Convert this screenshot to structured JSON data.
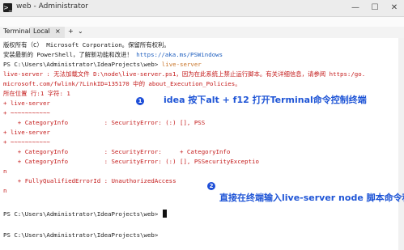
{
  "window": {
    "title": "web - Administrator",
    "app_icon": ">_",
    "minimize": "—",
    "maximize": "☐",
    "close": "✕"
  },
  "tabs": {
    "terminal_label": "Terminal:",
    "active_tab": "Local",
    "close": "×",
    "add": "+",
    "menu": "⌄"
  },
  "terminal": {
    "copyright": "版权所有（C） Microsoft Corporation。保留所有权利。",
    "install_prefix": "安装最新的 PowerShell，了解新功能和改进！",
    "install_link": "https://aka.ms/PSWindows",
    "prompt1": "PS C:\\Users\\Administrator\\IdeaProjects\\web>",
    "command1": " live-server",
    "err1": "live-server : 无法加载文件 D:\\node\\live-server.ps1，因为在此系统上禁止运行脚本。有关详细信息，请参阅 https:/go.",
    "err2": "microsoft.com/fwlink/?LinkID=135170 中的 about_Execution_Policies。",
    "err3": "所在位置 行:1 字符: 1",
    "err4": "+ live-server",
    "err5": "+ ~~~~~~~~~~~",
    "err6": "    + CategoryInfo          : SecurityError: (:) [], PSS",
    "err7": "+ live-server",
    "err8": "+ ~~~~~~~~~~~",
    "err9": "    + CategoryInfo          : SecurityError:     + CategoryInfo",
    "err10": "    + CategoryInfo          : SecurityError: (:) [], PSSecurityExceptio",
    "err11": "n",
    "err12": "    + FullyQualifiedErrorId : UnauthorizedAccess",
    "err13": "n",
    "prompt2": "PS C:\\Users\\Administrator\\IdeaProjects\\web>",
    "prompt3": "PS C:\\Users\\Administrator\\IdeaProjects\\web>"
  },
  "annotations": {
    "badge1": "1",
    "text1": "idea 按下alt + f12 打开Terminal命令控制终端",
    "badge2": "2",
    "text2": "直接在终端输入live-server node  脚本命令程序"
  }
}
